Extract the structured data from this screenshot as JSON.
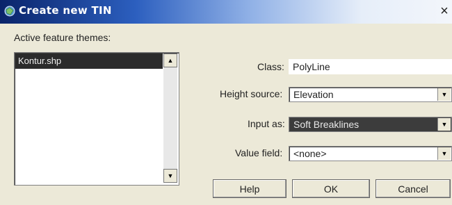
{
  "window": {
    "title": "Create new TIN",
    "close_glyph": "×"
  },
  "themes": {
    "label": "Active feature themes:",
    "items": [
      "Kontur.shp"
    ]
  },
  "form": {
    "class_label": "Class:",
    "class_value": "PolyLine",
    "height_source_label": "Height source:",
    "height_source_value": "Elevation",
    "input_as_label": "Input as:",
    "input_as_value": "Soft Breaklines",
    "value_field_label": "Value field:",
    "value_field_value": "<none>"
  },
  "buttons": {
    "help": "Help",
    "ok": "OK",
    "cancel": "Cancel"
  },
  "icons": {
    "title": "tin-globe-icon",
    "scroll_up": "scroll-up-arrow-icon",
    "scroll_down": "scroll-down-arrow-icon",
    "dropdown": "dropdown-arrow-icon"
  },
  "colors": {
    "titlebar_start": "#0a246a",
    "selection": "#2b2b2b",
    "dialog_bg": "#ece9d8"
  }
}
